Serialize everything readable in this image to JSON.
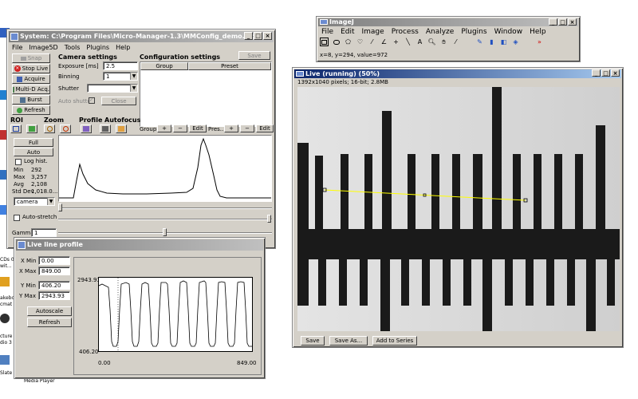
{
  "desktop": {
    "side_labels": [
      "CDs 0",
      "wit...",
      "akebo",
      "cmat",
      "cture",
      "dio 3",
      "Slate"
    ],
    "bottom_label": "Media Player"
  },
  "mm": {
    "title": "System: C:\\Program Files\\Micro-Manager-1.3\\MMConfig_demo.cfg",
    "menu": [
      "File",
      "Image5D",
      "Tools",
      "Plugins",
      "Help"
    ],
    "buttons": {
      "snap": "Snap",
      "stop_live": "Stop Live",
      "acquire": "Acquire",
      "multi_d": "Multi-D Acq.",
      "burst": "Burst",
      "refresh": "Refresh",
      "close": "Close",
      "save": "Save",
      "edit": "Edit",
      "full": "Full",
      "auto": "Auto"
    },
    "camera": {
      "heading": "Camera settings",
      "exposure_label": "Exposure [ms]",
      "exposure_value": "2.5",
      "binning_label": "Binning",
      "binning_value": "1",
      "shutter_label": "Shutter",
      "autoshutter_label": "Auto shutter"
    },
    "config": {
      "heading": "Configuration settings",
      "col_group": "Group",
      "col_preset": "Preset",
      "group_label": "Group:",
      "preset_label": "Pres..."
    },
    "sections": {
      "roi": "ROI",
      "zoom": "Zoom",
      "profile": "Profile",
      "autofocus": "Autofocus"
    },
    "stats": {
      "log_hist": "Log hist.",
      "min_label": "Min",
      "min_value": "292",
      "max_label": "Max",
      "max_value": "3,257",
      "avg_label": "Avg",
      "avg_value": "2,108",
      "std_label": "Std Dev",
      "std_value": "1,018.0..."
    },
    "channel": "camera",
    "auto_stretch": "Auto-stretch",
    "gamma_label": "Gamma",
    "gamma_value": "1"
  },
  "profile_win": {
    "title": "Live line profile",
    "xmin_label": "X Min",
    "xmin_value": "0.00",
    "xmax_label": "X Max",
    "xmax_value": "849.00",
    "ymin_label": "Y Min",
    "ymin_value": "406.20",
    "ymax_label": "Y Max",
    "ymax_value": "2943.93",
    "autoscale": "Autoscale",
    "refresh": "Refresh",
    "y_top": "2943.93",
    "y_bottom": "406.20",
    "x_left": "0.00",
    "x_right": "849.00"
  },
  "imagej": {
    "title": "ImageJ",
    "menu": [
      "File",
      "Edit",
      "Image",
      "Process",
      "Analyze",
      "Plugins",
      "Window",
      "Help"
    ],
    "status": "x=8, y=294, value=972"
  },
  "live": {
    "title": "Live (running) (50%)",
    "info": "1392x1040 pixels; 16-bit; 2.8MB",
    "save": "Save",
    "save_as": "Save As...",
    "add_series": "Add to Series"
  },
  "colors": {
    "title_active": "#0a246a",
    "face": "#d4d0c8",
    "profile_line": "#ffff00",
    "stop_icon": "#d02020"
  }
}
